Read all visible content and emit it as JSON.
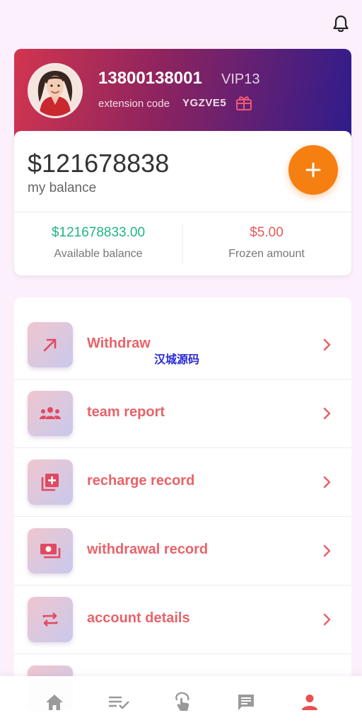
{
  "header": {
    "bell_icon": "bell-icon"
  },
  "profile": {
    "phone": "13800138001",
    "vip": "VIP13",
    "extension_label": "extension code",
    "extension_code": "YGZVE5",
    "gift_icon": "gift-icon"
  },
  "balance": {
    "amount": "$121678838",
    "label": "my balance",
    "add_icon": "plus-icon",
    "available": {
      "value": "$121678833.00",
      "label": "Available balance"
    },
    "frozen": {
      "value": "$5.00",
      "label": "Frozen amount"
    }
  },
  "menu": {
    "items": [
      {
        "label": "Withdraw",
        "icon": "arrow-up-right-icon"
      },
      {
        "label": "team report",
        "icon": "team-icon"
      },
      {
        "label": "recharge record",
        "icon": "add-stack-icon"
      },
      {
        "label": "withdrawal record",
        "icon": "money-icon"
      },
      {
        "label": "account details",
        "icon": "swap-icon"
      }
    ]
  },
  "watermark": "汉城源码",
  "tabbar": {
    "items": [
      "home-icon",
      "task-list-icon",
      "tap-icon",
      "message-icon",
      "profile-icon"
    ],
    "active": "profile-icon"
  },
  "colors": {
    "accent_orange": "#f57f11",
    "menu_text": "#e8636a",
    "available_green": "#1fb57f",
    "frozen_red": "#e85a5a",
    "tab_inactive": "#9a9a9a",
    "tab_active": "#e8514f"
  }
}
